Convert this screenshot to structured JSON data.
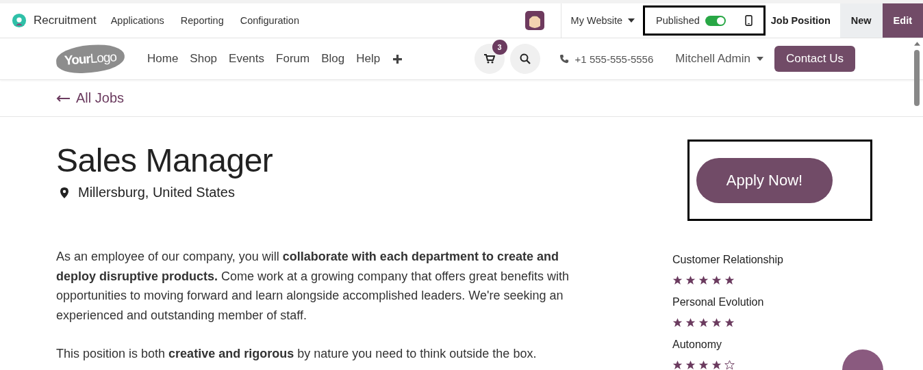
{
  "top_bar": {
    "app_name": "Recruitment",
    "menu": [
      "Applications",
      "Reporting",
      "Configuration"
    ],
    "website": "My Website",
    "published": {
      "label": "Published",
      "on": true,
      "highlighted": true
    },
    "record": "Job Position",
    "buttons": [
      {
        "label": "New",
        "kind": "secondary"
      },
      {
        "label": "Edit",
        "kind": "primary"
      }
    ]
  },
  "site_header": {
    "logo": "**Your**Logo",
    "nav": [
      "Home",
      "Shop",
      "Events",
      "Forum",
      "Blog",
      "Help"
    ],
    "cart_count": "3",
    "phone": "+1 555-555-5556",
    "user": "Mitchell Admin",
    "cta": "Contact Us"
  },
  "back_link": "All Jobs",
  "job": {
    "title": "Sales Manager",
    "location": "Millersburg, United States",
    "apply": {
      "label": "Apply Now!",
      "highlighted": true
    },
    "description": [
      "As an employee of our company, you will **collaborate with each department to create and deploy disruptive products.** Come work at a growing company that offers great benefits with opportunities to moving forward and learn alongside accomplished leaders. We're seeking an experienced and outstanding member of staff.",
      "This position is both **creative and rigorous** by nature you need to think outside the box."
    ]
  },
  "ratings": [
    {
      "label": "Customer Relationship",
      "stars": 5
    },
    {
      "label": "Personal Evolution",
      "stars": 5
    },
    {
      "label": "Autonomy",
      "stars": 4
    }
  ]
}
